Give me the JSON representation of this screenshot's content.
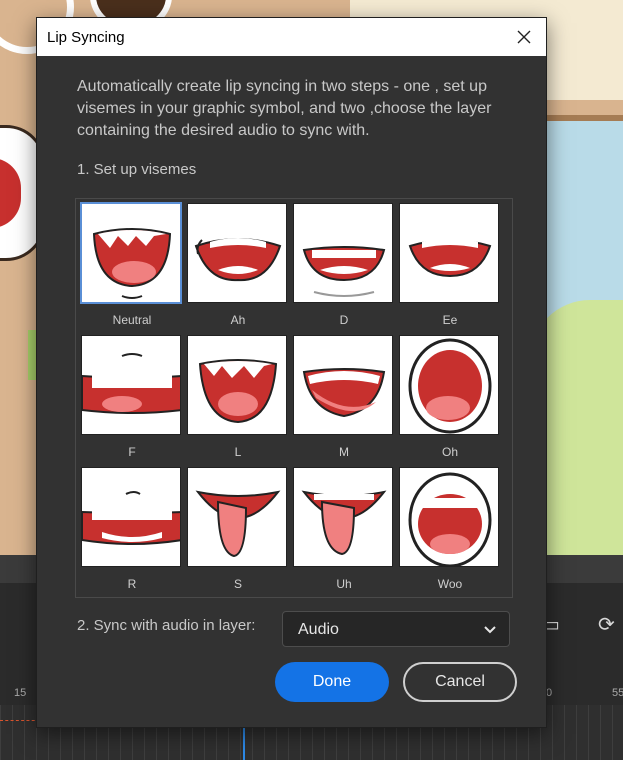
{
  "dialog": {
    "title": "Lip Syncing",
    "intro": "Automatically create lip syncing in two steps - one , set up visemes in your graphic symbol, and two ,choose the layer containing the desired audio to sync with.",
    "step1_label": "1. Set up visemes",
    "step2_label": "2. Sync with audio in layer:",
    "audio_select": {
      "value": "Audio"
    },
    "done_label": "Done",
    "cancel_label": "Cancel"
  },
  "visemes": [
    {
      "label": "Neutral",
      "shape": "neutral",
      "selected": true
    },
    {
      "label": "Ah",
      "shape": "ah"
    },
    {
      "label": "D",
      "shape": "d"
    },
    {
      "label": "Ee",
      "shape": "ee"
    },
    {
      "label": "F",
      "shape": "f"
    },
    {
      "label": "L",
      "shape": "l"
    },
    {
      "label": "M",
      "shape": "m"
    },
    {
      "label": "Oh",
      "shape": "oh"
    },
    {
      "label": "R",
      "shape": "r"
    },
    {
      "label": "S",
      "shape": "s"
    },
    {
      "label": "Uh",
      "shape": "uh"
    },
    {
      "label": "Woo",
      "shape": "woo"
    }
  ],
  "timeline": {
    "ruler_labels": [
      "15",
      "0",
      "55"
    ]
  },
  "colors": {
    "accent": "#1473e6",
    "lip": "#c7302e",
    "tongue": "#f08080"
  }
}
